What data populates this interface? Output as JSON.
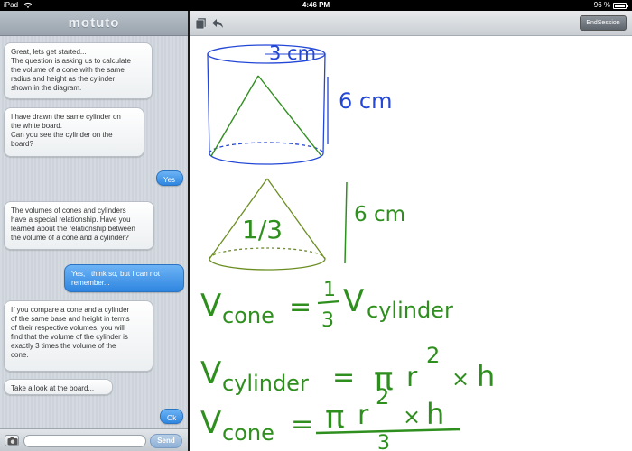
{
  "status_bar": {
    "carrier": "iPad",
    "time": "4:46 PM",
    "battery": "96 %"
  },
  "chat": {
    "logo": "motuto",
    "messages": [
      {
        "from": "tutor",
        "text": "Great, lets get started...\nThe question is asking us to calculate\nthe volume of a cone with the same\nradius and height as the cylinder\nshown in the diagram."
      },
      {
        "from": "tutor",
        "text": "I have drawn the same cylinder on\nthe white board.\nCan you see the cylinder on the\nboard?"
      },
      {
        "from": "student",
        "text": "Yes"
      },
      {
        "from": "tutor",
        "text": "The volumes of cones and cylinders\nhave a special relationship. Have you\nlearned about the relationship between\nthe volume of a cone and a cylinder?"
      },
      {
        "from": "student",
        "text": "Yes, I think so, but I can not\nremember..."
      },
      {
        "from": "tutor",
        "text": "If you compare a cone and a cylinder\nof the same base and height in terms\nof their respective volumes, you will\nfind that the volume of the cylinder is\nexactly 3 times the volume of the\ncone."
      },
      {
        "from": "tutor",
        "text": "Take a look at the board..."
      },
      {
        "from": "student",
        "text": "Ok"
      }
    ],
    "input": {
      "value": "",
      "placeholder": ""
    },
    "send_label": "Send"
  },
  "toolbar": {
    "end_session_label": "EndSession",
    "icons": [
      "pages-icon",
      "undo-arrow-icon"
    ]
  },
  "whiteboard": {
    "colors": {
      "blue": "#2347d6",
      "green": "#2f8f1e",
      "olive": "#6b8e23"
    },
    "cylinder_radius_label": "3 cm",
    "cylinder_height_label": "6 cm",
    "cone_fraction_label": "1/3",
    "cone_height_label": "6 cm",
    "formula_1": {
      "lhs_v": "V",
      "lhs_sub": "cone",
      "eq": "=",
      "num": "1",
      "den": "3",
      "rhs_v": "V",
      "rhs_sub": "cylinder"
    },
    "formula_2": {
      "lhs_v": "V",
      "lhs_sub": "cylinder",
      "eq": "=",
      "pi": "π",
      "r": "r",
      "exp": "2",
      "times": "×",
      "h": "h"
    },
    "formula_3": {
      "lhs_v": "V",
      "lhs_sub": "cone",
      "eq": "=",
      "pi": "π",
      "r": "r",
      "exp": "2",
      "times": "×",
      "h": "h",
      "den": "3"
    }
  }
}
